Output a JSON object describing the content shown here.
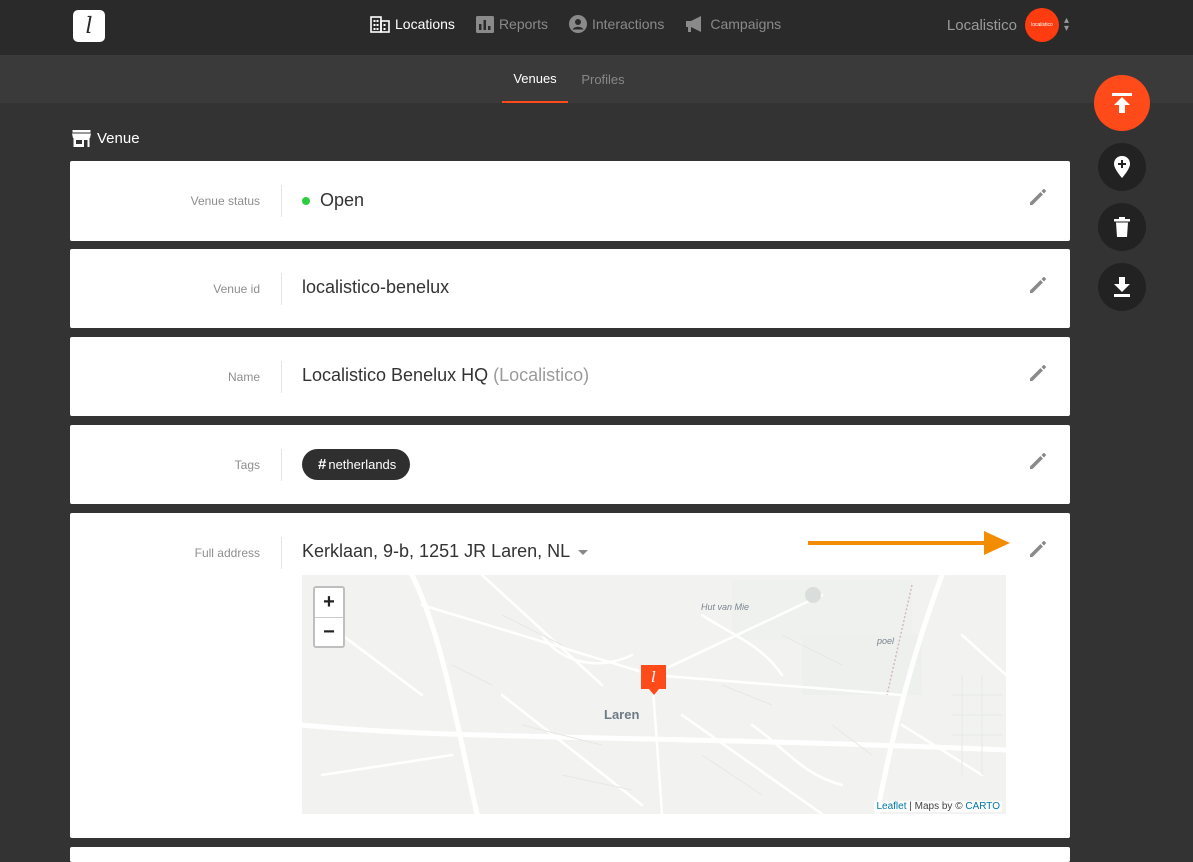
{
  "app": {
    "logo_letter": "l",
    "nav": [
      {
        "label": "Locations",
        "icon": "building-icon"
      },
      {
        "label": "Reports",
        "icon": "bar-chart-icon"
      },
      {
        "label": "Interactions",
        "icon": "user-circle-icon"
      },
      {
        "label": "Campaigns",
        "icon": "megaphone-icon"
      }
    ],
    "account_name": "Localistico",
    "account_avatar_text": "localistico"
  },
  "subnav": {
    "tabs": [
      {
        "label": "Venues",
        "active": true
      },
      {
        "label": "Profiles",
        "active": false
      }
    ]
  },
  "section": {
    "title": "Venue",
    "icon": "store-icon"
  },
  "fields": {
    "status": {
      "label": "Venue status",
      "value": "Open",
      "color": "#2ecc40"
    },
    "venue_id": {
      "label": "Venue id",
      "value": "localistico-benelux"
    },
    "name": {
      "label": "Name",
      "value": "Localistico Benelux HQ",
      "suffix": "(Localistico)"
    },
    "tags": {
      "label": "Tags",
      "items": [
        "netherlands"
      ]
    },
    "address": {
      "label": "Full address",
      "value": "Kerklaan, 9-b, 1251 JR Laren, NL"
    }
  },
  "map": {
    "zoom_in": "+",
    "zoom_out": "−",
    "labels": {
      "hut": "Hut van Mie",
      "poel": "poel",
      "town": "Laren"
    },
    "marker_letter": "l",
    "attribution_leaflet": "Leaflet",
    "attribution_sep": " | Maps by © ",
    "attribution_carto": "CARTO"
  },
  "actions": [
    {
      "name": "scroll-top",
      "icon": "upload-top-icon"
    },
    {
      "name": "add-location",
      "icon": "map-pin-plus-icon"
    },
    {
      "name": "delete",
      "icon": "trash-icon"
    },
    {
      "name": "download",
      "icon": "download-icon"
    }
  ],
  "colors": {
    "accent": "#ff4a1a",
    "arrow": "#f28c00",
    "background": "#333333",
    "topbar": "#2a2a2a"
  }
}
